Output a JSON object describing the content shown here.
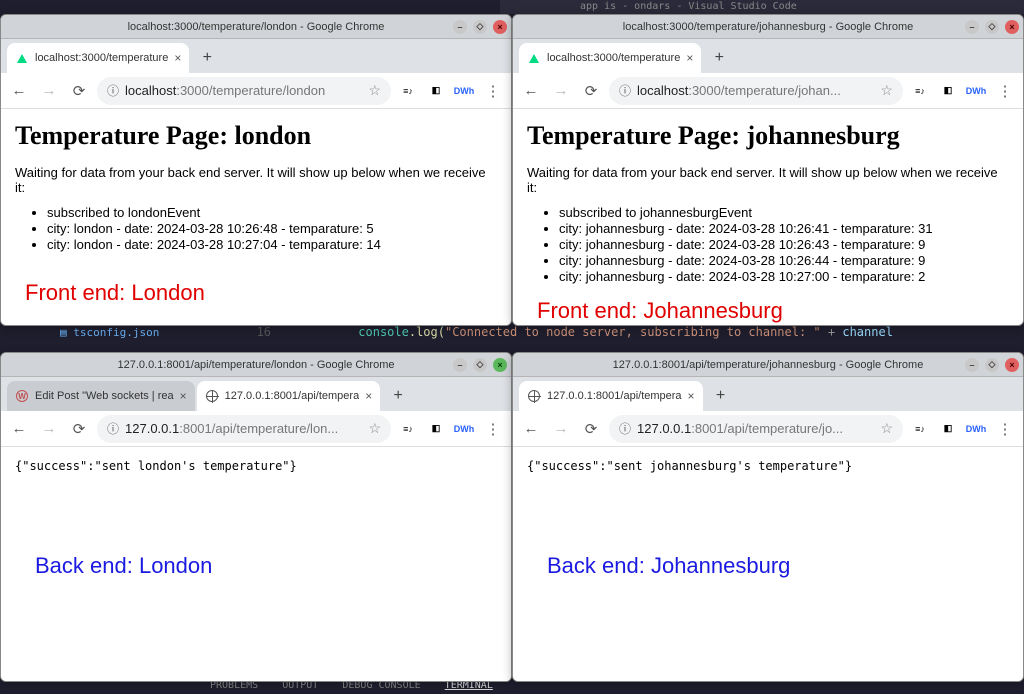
{
  "vscode": {
    "top_hint": "app is - ondars - Visual Studio Code",
    "file": "tsconfig.json",
    "lineno": "16",
    "code_prefix": "console",
    "code_fn": ".log(",
    "code_str": "\"Connected to node server, subscribing to channel: \"",
    "code_mid": " + ",
    "code_var": "channel",
    "bottom_problems": "PROBLEMS",
    "bottom_output": "OUTPUT",
    "bottom_debug": "DEBUG CONSOLE",
    "bottom_terminal": "TERMINAL"
  },
  "windows": {
    "tl": {
      "title": "localhost:3000/temperature/london - Google Chrome",
      "tab_title": "localhost:3000/temperature",
      "url_host": "localhost",
      "url_port": ":3000",
      "url_path": "/temperature/london",
      "page_heading": "Temperature Page: london",
      "page_waiting": "Waiting for data from your back end server. It will show up below when we receive it:",
      "items": [
        "subscribed to londonEvent",
        "city: london - date: 2024-03-28 10:26:48 - temparature: 5",
        "city: london - date: 2024-03-28 10:27:04 - temparature: 14"
      ],
      "annotation": "Front end: London"
    },
    "tr": {
      "title": "localhost:3000/temperature/johannesburg - Google Chrome",
      "tab_title": "localhost:3000/temperature",
      "url_host": "localhost",
      "url_port": ":3000",
      "url_path": "/temperature/johan...",
      "page_heading": "Temperature Page: johannesburg",
      "page_waiting": "Waiting for data from your back end server. It will show up below when we receive it:",
      "items": [
        "subscribed to johannesburgEvent",
        "city: johannesburg - date: 2024-03-28 10:26:41 - temparature: 31",
        "city: johannesburg - date: 2024-03-28 10:26:43 - temparature: 9",
        "city: johannesburg - date: 2024-03-28 10:26:44 - temparature: 9",
        "city: johannesburg - date: 2024-03-28 10:27:00 - temparature: 2"
      ],
      "annotation": "Front end: Johannesburg"
    },
    "bl": {
      "title": "127.0.0.1:8001/api/temperature/london - Google Chrome",
      "tab1_title": "Edit Post \"Web sockets | rea",
      "tab2_title": "127.0.0.1:8001/api/tempera",
      "url_host": "127.0.0.1",
      "url_port": ":8001",
      "url_path": "/api/temperature/lon...",
      "json": "{\"success\":\"sent london's temperature\"}",
      "annotation": "Back end: London"
    },
    "br": {
      "title": "127.0.0.1:8001/api/temperature/johannesburg - Google Chrome",
      "tab_title": "127.0.0.1:8001/api/tempera",
      "url_host": "127.0.0.1",
      "url_port": ":8001",
      "url_path": "/api/temperature/jo...",
      "json": "{\"success\":\"sent johannesburg's temperature\"}",
      "annotation": "Back end: Johannesburg"
    }
  },
  "icons": {
    "back": "←",
    "forward": "→",
    "reload": "⟳",
    "info": "ⓘ",
    "star": "☆",
    "ext_list": "≡♪",
    "ext_panel": "◧",
    "ext_dwh": "DWh",
    "menu": "⋮",
    "newtab": "+",
    "tabclose": "×",
    "min": "–",
    "max": "◇",
    "close": "×"
  }
}
